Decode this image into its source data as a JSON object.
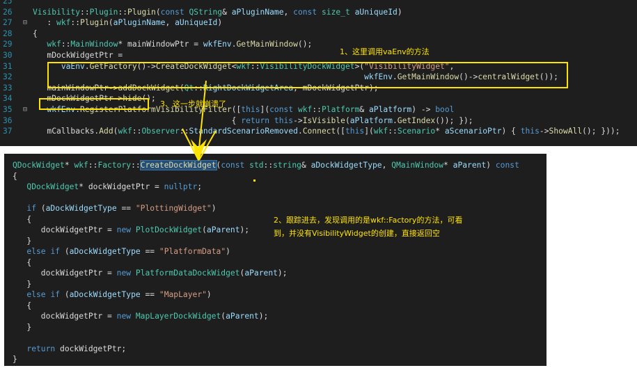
{
  "top_editor": {
    "lines": [
      {
        "num": "25",
        "fold": "",
        "html": ""
      },
      {
        "num": "26",
        "fold": "",
        "html": "<span class=\"ty\">Visibility</span>::<span class=\"ty\">Plugin</span>::<span class=\"fn\">Plugin</span>(<span class=\"kw\">const</span> <span class=\"ty\">QString</span>&amp; <span class=\"pm\">aPluginName</span>, <span class=\"kw\">const</span> <span class=\"ty\">size_t</span> <span class=\"pm\">aUniqueId</span>)"
      },
      {
        "num": "27",
        "fold": "⊟",
        "html": "   : <span class=\"ns\">wkf</span>::<span class=\"fn\">Plugin</span>(<span class=\"pm\">aPluginName</span>, <span class=\"pm\">aUniqueId</span>)"
      },
      {
        "num": "28",
        "fold": "",
        "html": "{"
      },
      {
        "num": "29",
        "fold": "",
        "html": "   <span class=\"ns\">wkf</span>::<span class=\"ty\">MainWindow</span>* mainWindowPtr = <span class=\"pm\">wkfEnv</span>.<span class=\"fn\">GetMainWindow</span>();"
      },
      {
        "num": "30",
        "fold": "",
        "html": "   <span class=\"mb\">mDockWidgetPtr</span> ="
      },
      {
        "num": "31",
        "fold": "",
        "html": "      <span class=\"pm\">vaEnv</span>.<span class=\"fn\">GetFactory</span>()-&gt;<span class=\"fn\">CreateDockWidget</span>&lt;<span class=\"ns\">wkf</span>::<span class=\"ty\">VisibilityDockWidget</span>&gt;(<span class=\"st\">\"VisibilityWidget\"</span>,"
      },
      {
        "num": "32",
        "fold": "",
        "html": "                                                                      <span class=\"pm\">wkfEnv</span>.<span class=\"fn\">GetMainWindow</span>()-&gt;<span class=\"fn\">centralWidget</span>());"
      },
      {
        "num": "33",
        "fold": "",
        "html": "   mainWindowPtr-&gt;<span class=\"fn\">addDockWidget</span>(<span class=\"ty\">Qt</span>::<span class=\"pm\">RightDockWidgetArea</span>, <span class=\"mb\">mDockWidgetPtr</span>);"
      },
      {
        "num": "34",
        "fold": "",
        "html": "   <span class=\"mb\">mDockWidgetPtr</span>-&gt;<span class=\"fn\">hide</span>();"
      },
      {
        "num": "35",
        "fold": "⊟",
        "html": "   <span class=\"pm\">wkfEnv</span>.<span class=\"fn\">RegisterPlatformVisibilityFilter</span>([<span class=\"kw\">this</span>](<span class=\"kw\">const</span> <span class=\"ns\">wkf</span>::<span class=\"ty\">Platform</span>&amp; <span class=\"pm\">aPlatform</span>) -&gt; <span class=\"kw\">bool</span>"
      },
      {
        "num": "36",
        "fold": "",
        "html": "                                          { <span class=\"kw\">return</span> <span class=\"kw\">this</span>-&gt;<span class=\"fn\">IsVisible</span>(<span class=\"pm\">aPlatform</span>.<span class=\"fn\">GetIndex</span>()); });"
      },
      {
        "num": "37",
        "fold": "",
        "html": "   <span class=\"mb\">mCallbacks</span>.<span class=\"fn\">Add</span>(<span class=\"ns\">wkf</span>::<span class=\"ty\">Observer</span>::<span class=\"pm\">StandardScenarioRemoved</span>.<span class=\"fn\">Connect</span>([<span class=\"kw\">this</span>](<span class=\"ns\">wkf</span>::<span class=\"ty\">Scenario</span>* <span class=\"pm\">aScenarioPtr</span>) { <span class=\"kw\">this</span>-&gt;<span class=\"fn\">ShowAll</span>(); }));"
      }
    ]
  },
  "bottom_editor": {
    "lines": [
      {
        "html": "<span class=\"ty\">QDockWidget</span>* <span class=\"ns\">wkf</span>::<span class=\"ty\">Factory</span>::<span class=\"fn hl\">CreateDockWidget</span>(<span class=\"kw\">const</span> <span class=\"ns\">std</span>::<span class=\"ty\">string</span>&amp; <span class=\"pm\">aDockWidgetType</span>, <span class=\"ty\">QMainWindow</span>* <span class=\"pm\">aParent</span>) <span class=\"kw\">const</span>"
      },
      {
        "html": "{"
      },
      {
        "html": "   <span class=\"ty\">QDockWidget</span>* dockWidgetPtr = <span class=\"kw\">nullptr</span>;"
      },
      {
        "html": ""
      },
      {
        "html": "   <span class=\"kw\">if</span> (<span class=\"pm\">aDockWidgetType</span> == <span class=\"st\">\"PlottingWidget\"</span>)"
      },
      {
        "html": "   {"
      },
      {
        "html": "      dockWidgetPtr = <span class=\"kw\">new</span> <span class=\"ty\">PlotDockWidget</span>(<span class=\"pm\">aParent</span>);"
      },
      {
        "html": "   }"
      },
      {
        "html": "   <span class=\"kw\">else</span> <span class=\"kw\">if</span> (<span class=\"pm\">aDockWidgetType</span> == <span class=\"st\">\"PlatformData\"</span>)"
      },
      {
        "html": "   {"
      },
      {
        "html": "      dockWidgetPtr = <span class=\"kw\">new</span> <span class=\"ty\">PlatformDataDockWidget</span>(<span class=\"pm\">aParent</span>);"
      },
      {
        "html": "   }"
      },
      {
        "html": "   <span class=\"kw\">else</span> <span class=\"kw\">if</span> (<span class=\"pm\">aDockWidgetType</span> == <span class=\"st\">\"MapLayer\"</span>)"
      },
      {
        "html": "   {"
      },
      {
        "html": "      dockWidgetPtr = <span class=\"kw\">new</span> <span class=\"ty\">MapLayerDockWidget</span>(<span class=\"pm\">aParent</span>);"
      },
      {
        "html": "   }"
      },
      {
        "html": ""
      },
      {
        "html": "   <span class=\"kw\">return</span> dockWidgetPtr;"
      },
      {
        "html": "}"
      }
    ]
  },
  "annotations": {
    "note1": "1、这里调用vaEnv的方法",
    "note2_line1": "2、跟踪进去，发现调用的是wkf::Factory的方法，可看",
    "note2_line2": "到，并没有VisibilityWidget的创建，直接返回空",
    "note3": "3、这一步就崩溃了"
  },
  "colors": {
    "editor_background": "#1e1e1e",
    "annotation": "#ffe400",
    "line_number": "#2b91af"
  }
}
